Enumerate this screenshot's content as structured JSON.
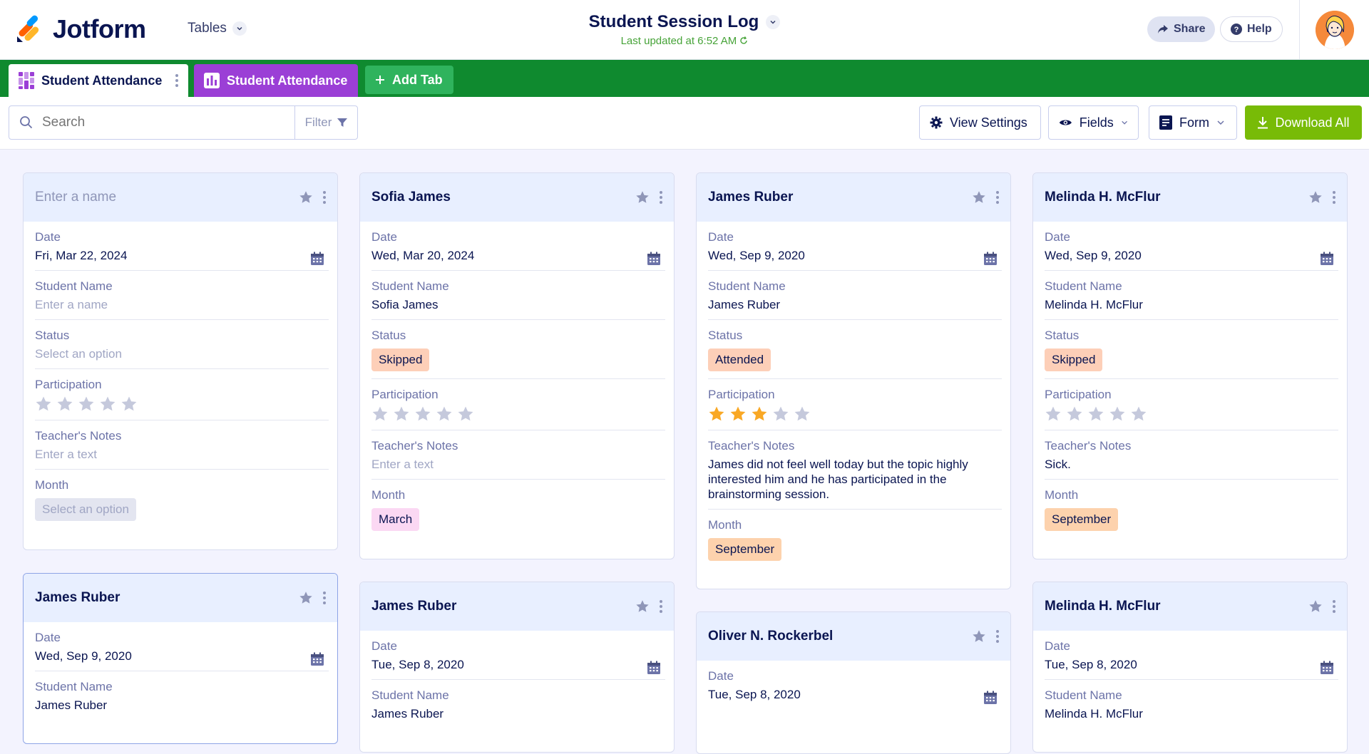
{
  "app": {
    "brand": "Jotform",
    "tables_label": "Tables",
    "title": "Student Session Log",
    "last_updated": "Last updated at 6:52 AM"
  },
  "header": {
    "share_label": "Share",
    "help_label": "Help"
  },
  "tabs": [
    {
      "label": "Student Attendance"
    },
    {
      "label": "Student Attendance"
    },
    {
      "label": "Add Tab"
    }
  ],
  "toolbar": {
    "search_placeholder": "Search",
    "filter_label": "Filter",
    "view_settings_label": "View Settings",
    "fields_label": "Fields",
    "form_label": "Form",
    "download_label": "Download All"
  },
  "labels": {
    "date": "Date",
    "student_name": "Student Name",
    "status": "Status",
    "participation": "Participation",
    "notes": "Teacher's Notes",
    "month": "Month"
  },
  "placeholders": {
    "name": "Enter a name",
    "option": "Select an option",
    "text": "Enter a text"
  },
  "colors": {
    "brand_green": "#0f8a2f",
    "purple_tab": "#9b3fd6",
    "download_green": "#78bb07",
    "star_filled": "#f9a825",
    "star_empty": "#c5c9dc"
  },
  "cards": [
    {
      "title": "",
      "date": "Fri, Mar 22, 2024",
      "student_name": "",
      "status": "",
      "participation": 0,
      "notes": "",
      "month": ""
    },
    {
      "title": "Sofia James",
      "date": "Wed, Mar 20, 2024",
      "student_name": "Sofia James",
      "status": "Skipped",
      "participation": 0,
      "notes": "",
      "month": "March"
    },
    {
      "title": "James Ruber",
      "date": "Wed, Sep 9, 2020",
      "student_name": "James Ruber",
      "status": "Attended",
      "participation": 3,
      "notes": "James did not feel well today but the topic highly interested him and he has participated in the brainstorming session.",
      "month": "September"
    },
    {
      "title": "Melinda H. McFlur",
      "date": "Wed, Sep 9, 2020",
      "student_name": "Melinda H. McFlur",
      "status": "Skipped",
      "participation": 0,
      "notes": "Sick.",
      "month": "September"
    },
    {
      "title": "James Ruber",
      "date": "Wed, Sep 9, 2020",
      "student_name": "James Ruber"
    },
    {
      "title": "James Ruber",
      "date": "Tue, Sep 8, 2020",
      "student_name": "James Ruber"
    },
    {
      "title": "Oliver N. Rockerbel",
      "date": "Tue, Sep 8, 2020"
    },
    {
      "title": "Melinda H. McFlur",
      "date": "Tue, Sep 8, 2020",
      "student_name": "Melinda H. McFlur"
    }
  ]
}
